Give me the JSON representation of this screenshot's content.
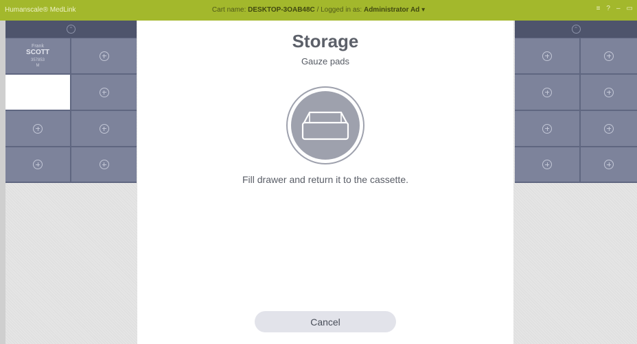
{
  "titlebar": {
    "brand": "Humanscale® MedLink",
    "cart_prefix": "Cart name:",
    "cart_name": "DESKTOP-3OAB48C",
    "separator": "/",
    "logged_prefix": "Logged in as:",
    "user": "Administrator Ad",
    "user_caret": "▾",
    "menu_glyph": "≡",
    "help_glyph": "?",
    "minimize_glyph": "–",
    "restore_glyph": "▭"
  },
  "left_cassette": {
    "patient": {
      "first": "Frank",
      "last": "SCOTT",
      "id": "357853",
      "sex": "M"
    }
  },
  "modal": {
    "title": "Storage",
    "subtitle": "Gauze pads",
    "icon": "drawer-icon",
    "message": "Fill drawer and return it to the cassette.",
    "cancel_label": "Cancel"
  },
  "colors": {
    "titlebar": "#a3b82c",
    "cassette": "#5f6680",
    "slot": "#7d839b",
    "icon_circle": "#9ea1ad"
  }
}
